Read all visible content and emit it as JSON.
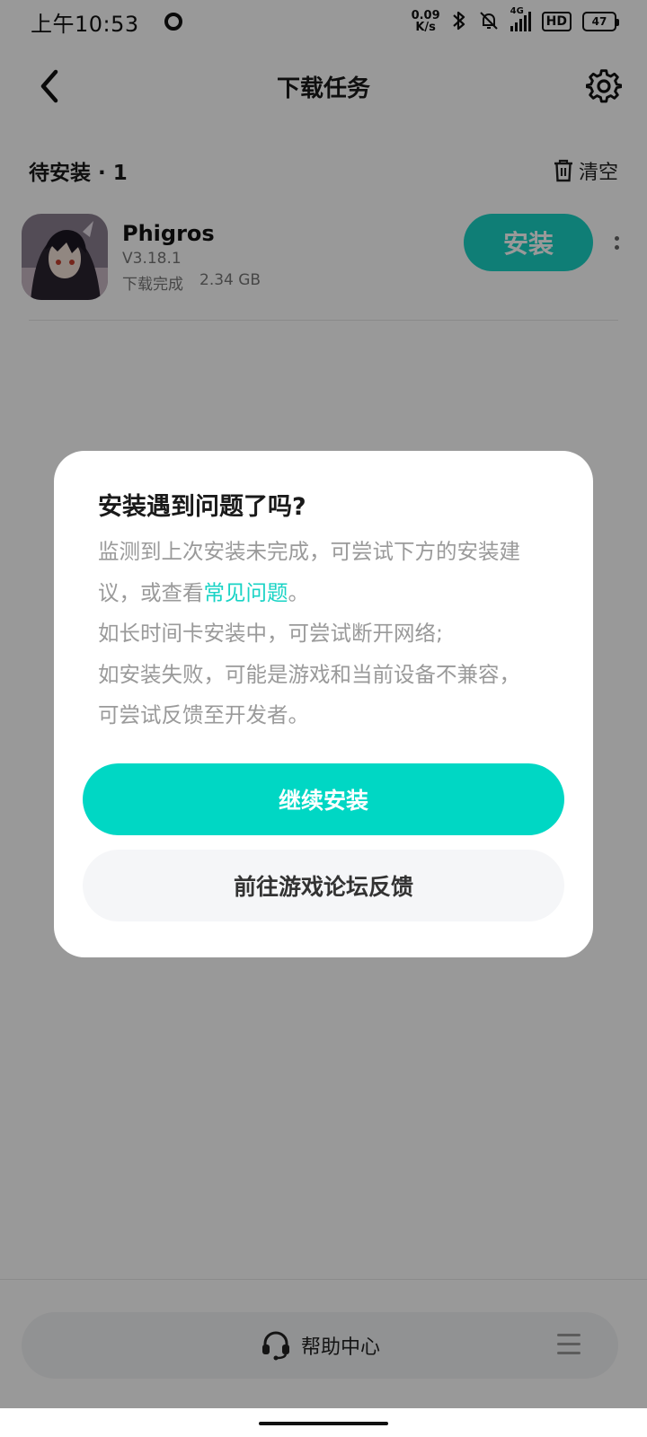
{
  "status_bar": {
    "time": "上午10:53",
    "net_speed_value": "0.09",
    "net_speed_unit": "K/s",
    "network_type": "4G",
    "hd": "HD",
    "battery": "47",
    "icons": [
      "circle-indicator-icon",
      "bluetooth-icon",
      "bell-muted-icon",
      "signal-icon",
      "battery-icon"
    ]
  },
  "header": {
    "title": "下载任务",
    "back_icon": "chevron-left-icon",
    "settings_icon": "gear-icon"
  },
  "section": {
    "title": "待安装 · 1",
    "clear_label": "清空"
  },
  "download_items": [
    {
      "name": "Phigros",
      "version": "V3.18.1",
      "status": "下载完成",
      "size": "2.34 GB",
      "action_label": "安装"
    }
  ],
  "dialog": {
    "title": "安装遇到问题了吗?",
    "body_line1": "监测到上次安装未完成，可尝试下方的安装建",
    "body_line2_prefix": "议，或查看",
    "faq_link": "常见问题",
    "body_line2_suffix": "。",
    "body_line3": "如长时间卡安装中，可尝试断开网络;",
    "body_line4": "如安装失败，可能是游戏和当前设备不兼容，",
    "body_line5": "可尝试反馈至开发者。",
    "primary_label": "继续安装",
    "secondary_label": "前往游戏论坛反馈"
  },
  "bottom_bar": {
    "help_label": "帮助中心"
  },
  "colors": {
    "accent": "#00d7c4",
    "overlay": "rgba(0,0,0,0.40)",
    "secondary_button": "#f5f6f8",
    "muted_text": "#9a9a9a"
  }
}
